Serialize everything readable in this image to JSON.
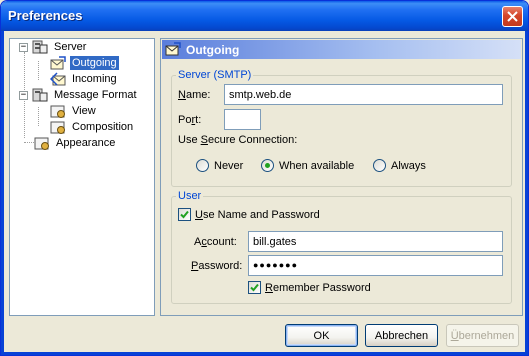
{
  "window": {
    "title": "Preferences"
  },
  "tree": {
    "items": [
      {
        "label": "Server",
        "icon": "server-icon",
        "expanded": true
      },
      {
        "label": "Outgoing",
        "icon": "outgoing-mail-icon",
        "selected": true
      },
      {
        "label": "Incoming",
        "icon": "incoming-mail-icon"
      },
      {
        "label": "Message Format",
        "icon": "message-format-icon",
        "expanded": true
      },
      {
        "label": "View",
        "icon": "view-settings-icon"
      },
      {
        "label": "Composition",
        "icon": "composition-settings-icon"
      },
      {
        "label": "Appearance",
        "icon": "appearance-icon"
      }
    ]
  },
  "pane": {
    "title": "Outgoing",
    "server_group": {
      "legend": "Server (SMTP)",
      "name_label_u": "N",
      "name_label_rest": "ame:",
      "name_value": "smtp.web.de",
      "port_label_pre": "Po",
      "port_label_u": "r",
      "port_label_rest": "t:",
      "port_value": "",
      "secure_label_pre": "Use ",
      "secure_label_u": "S",
      "secure_label_rest": "ecure Connection:",
      "options": [
        {
          "label": "Never",
          "selected": false
        },
        {
          "label": "When available",
          "selected": true
        },
        {
          "label": "Always",
          "selected": false
        }
      ]
    },
    "user_group": {
      "legend": "User",
      "use_name_u": "U",
      "use_name_rest": "se Name and Password",
      "use_name_checked": true,
      "account_label_pre": "A",
      "account_label_u": "c",
      "account_label_rest": "count:",
      "account_value": "bill.gates",
      "password_label_u": "P",
      "password_label_rest": "assword:",
      "password_value": "●●●●●●●",
      "remember_u": "R",
      "remember_rest": "emember Password",
      "remember_checked": true
    }
  },
  "buttons": {
    "ok": "OK",
    "cancel": "Abbrechen",
    "apply_u": "Ü",
    "apply_rest": "bernehmen"
  },
  "colors": {
    "titlebar": "#0559e4",
    "selection": "#316ac5",
    "legend": "#0046d5",
    "radio_on": "#21a121"
  }
}
